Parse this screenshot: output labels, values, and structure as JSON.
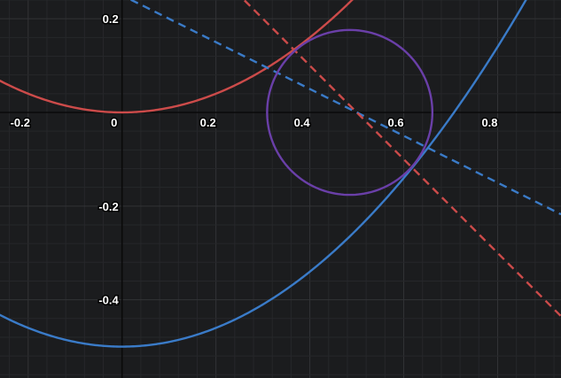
{
  "chart_data": {
    "type": "line",
    "xlim": [
      -0.26,
      0.935
    ],
    "ylim": [
      -0.567,
      0.24
    ],
    "x_tick_labels": [
      {
        "value": -0.2,
        "label": "-0.2"
      },
      {
        "value": 0,
        "label": "0"
      },
      {
        "value": 0.2,
        "label": "0.2"
      },
      {
        "value": 0.4,
        "label": "0.4"
      },
      {
        "value": 0.6,
        "label": "0.6"
      },
      {
        "value": 0.8,
        "label": "0.8"
      }
    ],
    "y_tick_labels": [
      {
        "value": 0.2,
        "label": "0.2"
      },
      {
        "value": -0.2,
        "label": "-0.2"
      },
      {
        "value": -0.4,
        "label": "-0.4"
      }
    ],
    "grid": true,
    "series": [
      {
        "kind": "parabola",
        "vertex": [
          0,
          0
        ],
        "a": 1,
        "color": "#cc4b4a",
        "dashed": false
      },
      {
        "kind": "parabola",
        "vertex": [
          0,
          -0.5
        ],
        "a": 1,
        "color": "#3a7bc8",
        "dashed": false
      },
      {
        "kind": "line",
        "point": [
          0.5,
          0
        ],
        "slope": -0.5,
        "color": "#3a7bc8",
        "dashed": true
      },
      {
        "kind": "line",
        "point": [
          0.5,
          0
        ],
        "slope": -1,
        "color": "#cc4b4a",
        "dashed": true
      },
      {
        "kind": "circle",
        "center": [
          0.485,
          0
        ],
        "radius": 0.176,
        "color": "#6a3fa8",
        "dashed": false
      }
    ]
  },
  "colors": {
    "background": "#1b1c1e",
    "minor_grid": "#26272a",
    "major_grid": "#323336",
    "axis": "#0a0a0a"
  }
}
